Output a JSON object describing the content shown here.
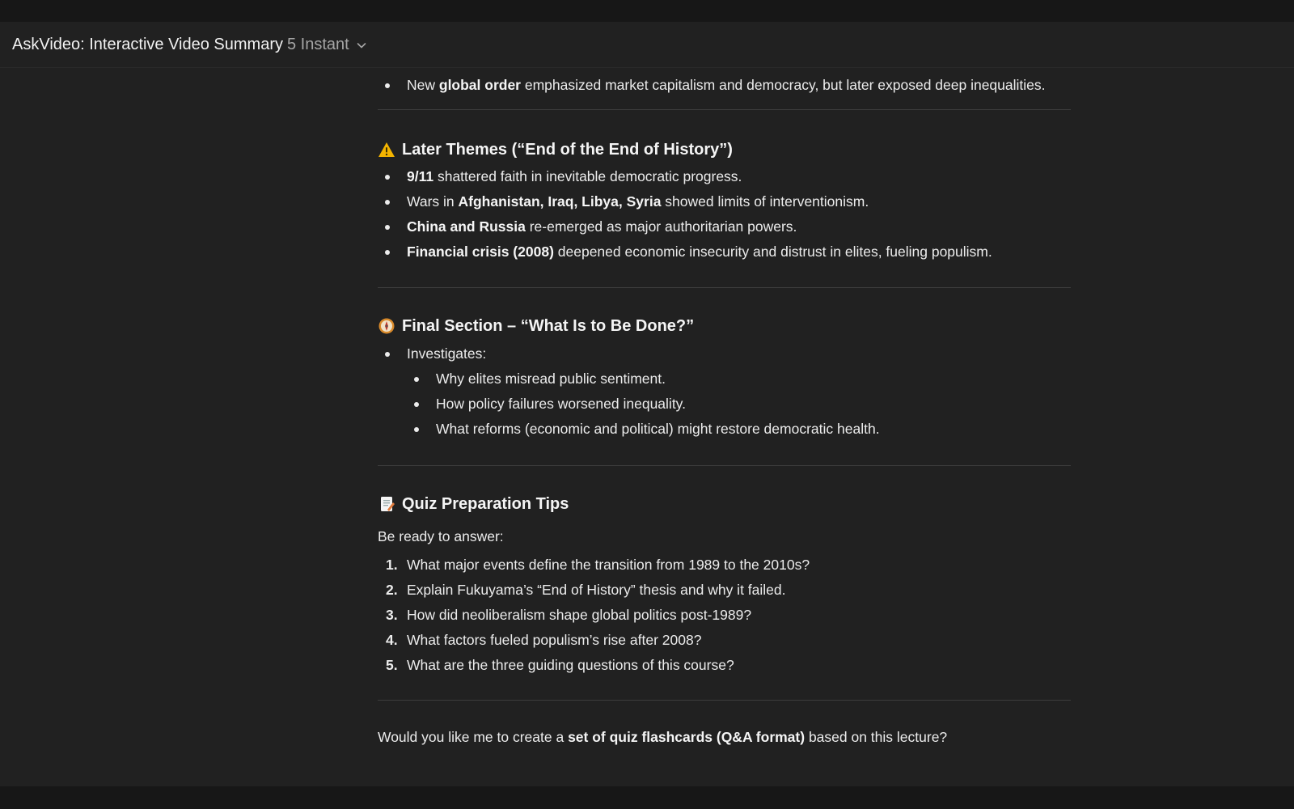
{
  "header": {
    "app_title": "AskVideo: Interactive Video Summary",
    "model_name": "5 Instant",
    "chevron_icon": "chevron-down-icon"
  },
  "top_partial": {
    "item": {
      "pre": "New ",
      "bold": "global order",
      "post": " emphasized market capitalism and democracy, but later exposed deep inequalities."
    }
  },
  "later_themes": {
    "icon": "warning-icon",
    "title": "Later Themes (“End of the End of History”)",
    "items": [
      {
        "bold": "9/11",
        "post": " shattered faith in inevitable democratic progress."
      },
      {
        "pre": "Wars in ",
        "bold": "Afghanistan, Iraq, Libya, Syria",
        "post": " showed limits of interventionism."
      },
      {
        "bold": "China and Russia",
        "post": " re-emerged as major authoritarian powers."
      },
      {
        "bold": "Financial crisis (2008)",
        "post": " deepened economic insecurity and distrust in elites, fueling populism."
      }
    ]
  },
  "final_section": {
    "icon": "compass-icon",
    "title": "Final Section – “What Is to Be Done?”",
    "lead": "Investigates:",
    "sub_items": [
      "Why elites misread public sentiment.",
      "How policy failures worsened inequality.",
      "What reforms (economic and political) might restore democratic health."
    ]
  },
  "quiz_tips": {
    "icon": "memo-icon",
    "title": "Quiz Preparation Tips",
    "intro": "Be ready to answer:",
    "questions": [
      {
        "num": "1.",
        "text": "What major events define the transition from 1989 to the 2010s?"
      },
      {
        "num": "2.",
        "text": "Explain Fukuyama’s “End of History” thesis and why it failed."
      },
      {
        "num": "3.",
        "text": "How did neoliberalism shape global politics post-1989?"
      },
      {
        "num": "4.",
        "text": "What factors fueled populism’s rise after 2008?"
      },
      {
        "num": "5.",
        "text": "What are the three guiding questions of this course?"
      }
    ]
  },
  "closing": {
    "pre": "Would you like me to create a ",
    "bold": "set of quiz flashcards (Q&A format)",
    "post": " based on this lecture?"
  }
}
